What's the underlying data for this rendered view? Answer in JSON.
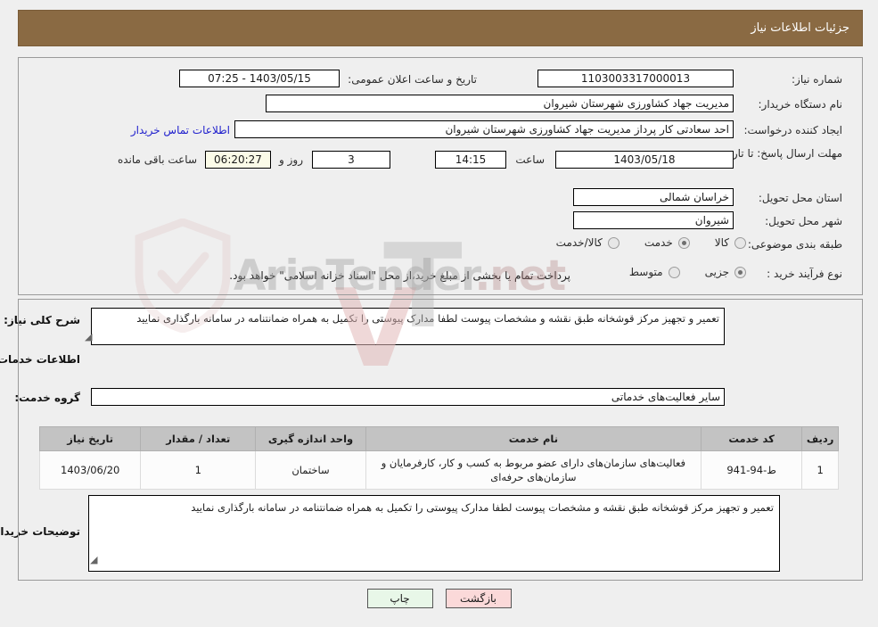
{
  "header": {
    "title": "جزئیات اطلاعات نیاز"
  },
  "form": {
    "need_number_label": "شماره نیاز:",
    "need_number_value": "1103003317000013",
    "public_announce_label": "تاریخ و ساعت اعلان عمومی:",
    "public_announce_value": "1403/05/15 - 07:25",
    "buyer_org_label": "نام دستگاه خریدار:",
    "buyer_org_value": "مدیریت جهاد کشاورزی شهرستان شیروان",
    "creator_label": "ایجاد کننده درخواست:",
    "creator_value": "احد سعادتی کار پرداز مدیریت جهاد کشاورزی شهرستان شیروان",
    "contact_link": "اطلاعات تماس خریدار",
    "deadline_label": "مهلت ارسال پاسخ: تا تاریخ:",
    "deadline_date": "1403/05/18",
    "hour_label": "ساعت",
    "deadline_hour": "14:15",
    "days_value": "3",
    "days_and_label": "روز و",
    "remaining_value": "06:20:27",
    "remaining_label": "ساعت باقی مانده",
    "province_label": "استان محل تحویل:",
    "province_value": "خراسان شمالی",
    "city_label": "شهر محل تحویل:",
    "city_value": "شیروان",
    "category_label": "طبقه بندی موضوعی:",
    "category_options": [
      {
        "label": "کالا",
        "selected": false
      },
      {
        "label": "خدمت",
        "selected": true
      },
      {
        "label": "کالا/خدمت",
        "selected": false
      }
    ],
    "process_label": "نوع فرآیند خرید :",
    "process_options": [
      {
        "label": "جزیی",
        "selected": true
      },
      {
        "label": "متوسط",
        "selected": false
      }
    ],
    "payment_note": "پرداخت تمام یا بخشی از مبلغ خرید،از محل \"اسناد خزانه اسلامی\" خواهد بود."
  },
  "description": {
    "label": "شرح کلی نیاز:",
    "value": "تعمیر و تجهیز مرکز قوشخانه طبق نقشه و مشخصات پیوست لطفا مدارک پیوستی را تکمیل به همراه ضمانتنامه در سامانه بارگذاری نمایید"
  },
  "services_section": {
    "title": "اطلاعات خدمات مورد نیاز",
    "group_label": "گروه خدمت:",
    "group_value": "سایر فعالیت‌های خدماتی"
  },
  "table": {
    "columns": [
      "ردیف",
      "کد خدمت",
      "نام خدمت",
      "واحد اندازه گیری",
      "تعداد / مقدار",
      "تاریخ نیاز"
    ],
    "rows": [
      {
        "row_no": "1",
        "code": "ط-94-941",
        "name": "فعالیت‌های سازمان‌های دارای عضو مربوط به کسب و کار، کارفرمایان و سازمان‌های حرفه‌ای",
        "unit": "ساختمان",
        "qty": "1",
        "need_date": "1403/06/20"
      }
    ]
  },
  "buyer_comments": {
    "label": "توضیحات خریدار:",
    "value": "تعمیر و تجهیز مرکز قوشخانه طبق نقشه و مشخصات پیوست لطفا مدارک پیوستی را تکمیل به همراه ضمانتنامه در سامانه بارگذاری نمایید"
  },
  "buttons": {
    "print": "چاپ",
    "back": "بازگشت"
  },
  "watermark": {
    "text": "AriaTender",
    "suffix": ".net"
  }
}
